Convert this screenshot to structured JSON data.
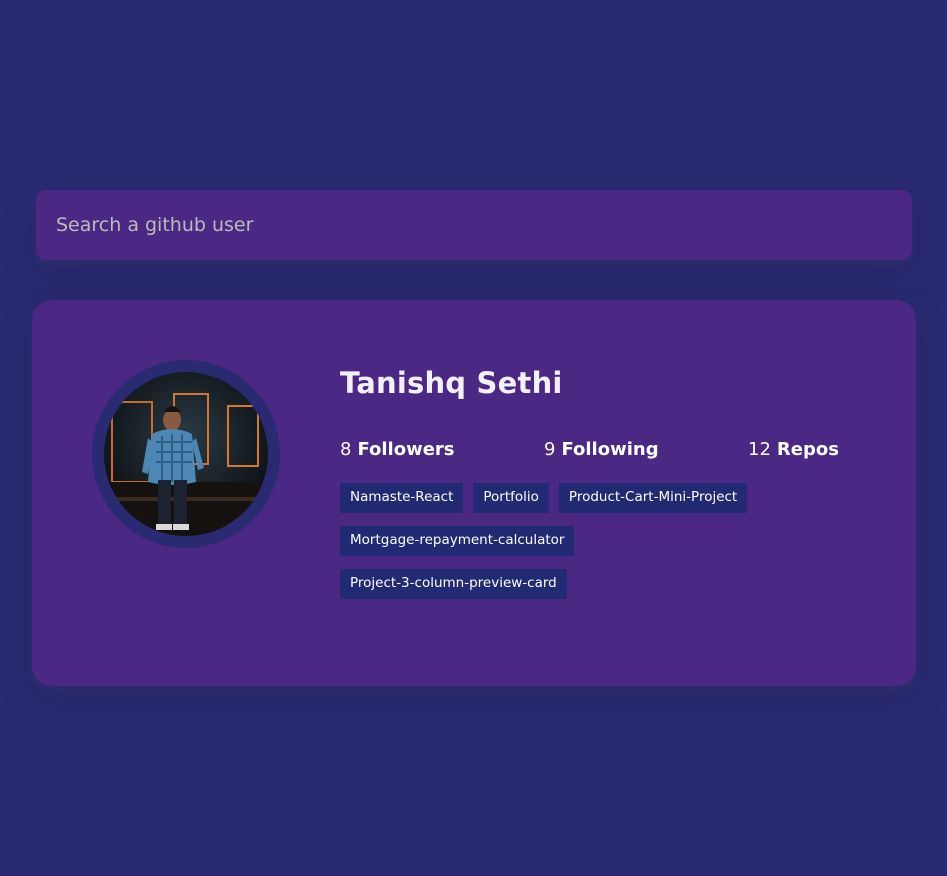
{
  "search": {
    "placeholder": "Search a github user"
  },
  "user": {
    "name": "Tanishq Sethi",
    "avatar_icon": "user-avatar-photo"
  },
  "stats": {
    "followers": {
      "value": "8",
      "label": "Followers"
    },
    "following": {
      "value": "9",
      "label": "Following"
    },
    "repos": {
      "value": "12",
      "label": "Repos"
    }
  },
  "repos": [
    "Namaste-React",
    "Portfolio",
    "Product-Cart-Mini-Project",
    "Mortgage-repayment-calculator",
    "Project-3-column-preview-card"
  ],
  "colors": {
    "background": "#2a2a72",
    "card": "#4c2885",
    "repo_tag": "#212a72",
    "text": "#ffffff"
  }
}
